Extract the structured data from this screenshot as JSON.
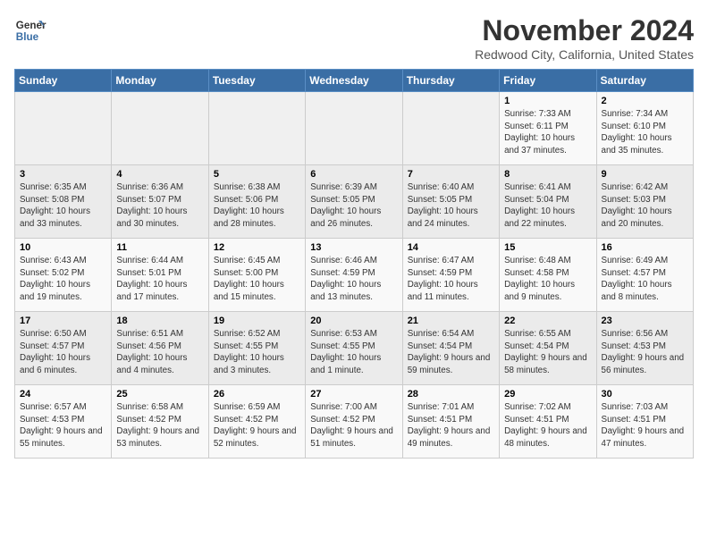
{
  "header": {
    "logo_line1": "General",
    "logo_line2": "Blue",
    "month": "November 2024",
    "location": "Redwood City, California, United States"
  },
  "weekdays": [
    "Sunday",
    "Monday",
    "Tuesday",
    "Wednesday",
    "Thursday",
    "Friday",
    "Saturday"
  ],
  "weeks": [
    [
      {
        "day": "",
        "info": ""
      },
      {
        "day": "",
        "info": ""
      },
      {
        "day": "",
        "info": ""
      },
      {
        "day": "",
        "info": ""
      },
      {
        "day": "",
        "info": ""
      },
      {
        "day": "1",
        "info": "Sunrise: 7:33 AM\nSunset: 6:11 PM\nDaylight: 10 hours\nand 37 minutes."
      },
      {
        "day": "2",
        "info": "Sunrise: 7:34 AM\nSunset: 6:10 PM\nDaylight: 10 hours\nand 35 minutes."
      }
    ],
    [
      {
        "day": "3",
        "info": "Sunrise: 6:35 AM\nSunset: 5:08 PM\nDaylight: 10 hours\nand 33 minutes."
      },
      {
        "day": "4",
        "info": "Sunrise: 6:36 AM\nSunset: 5:07 PM\nDaylight: 10 hours\nand 30 minutes."
      },
      {
        "day": "5",
        "info": "Sunrise: 6:38 AM\nSunset: 5:06 PM\nDaylight: 10 hours\nand 28 minutes."
      },
      {
        "day": "6",
        "info": "Sunrise: 6:39 AM\nSunset: 5:05 PM\nDaylight: 10 hours\nand 26 minutes."
      },
      {
        "day": "7",
        "info": "Sunrise: 6:40 AM\nSunset: 5:05 PM\nDaylight: 10 hours\nand 24 minutes."
      },
      {
        "day": "8",
        "info": "Sunrise: 6:41 AM\nSunset: 5:04 PM\nDaylight: 10 hours\nand 22 minutes."
      },
      {
        "day": "9",
        "info": "Sunrise: 6:42 AM\nSunset: 5:03 PM\nDaylight: 10 hours\nand 20 minutes."
      }
    ],
    [
      {
        "day": "10",
        "info": "Sunrise: 6:43 AM\nSunset: 5:02 PM\nDaylight: 10 hours\nand 19 minutes."
      },
      {
        "day": "11",
        "info": "Sunrise: 6:44 AM\nSunset: 5:01 PM\nDaylight: 10 hours\nand 17 minutes."
      },
      {
        "day": "12",
        "info": "Sunrise: 6:45 AM\nSunset: 5:00 PM\nDaylight: 10 hours\nand 15 minutes."
      },
      {
        "day": "13",
        "info": "Sunrise: 6:46 AM\nSunset: 4:59 PM\nDaylight: 10 hours\nand 13 minutes."
      },
      {
        "day": "14",
        "info": "Sunrise: 6:47 AM\nSunset: 4:59 PM\nDaylight: 10 hours\nand 11 minutes."
      },
      {
        "day": "15",
        "info": "Sunrise: 6:48 AM\nSunset: 4:58 PM\nDaylight: 10 hours\nand 9 minutes."
      },
      {
        "day": "16",
        "info": "Sunrise: 6:49 AM\nSunset: 4:57 PM\nDaylight: 10 hours\nand 8 minutes."
      }
    ],
    [
      {
        "day": "17",
        "info": "Sunrise: 6:50 AM\nSunset: 4:57 PM\nDaylight: 10 hours\nand 6 minutes."
      },
      {
        "day": "18",
        "info": "Sunrise: 6:51 AM\nSunset: 4:56 PM\nDaylight: 10 hours\nand 4 minutes."
      },
      {
        "day": "19",
        "info": "Sunrise: 6:52 AM\nSunset: 4:55 PM\nDaylight: 10 hours\nand 3 minutes."
      },
      {
        "day": "20",
        "info": "Sunrise: 6:53 AM\nSunset: 4:55 PM\nDaylight: 10 hours\nand 1 minute."
      },
      {
        "day": "21",
        "info": "Sunrise: 6:54 AM\nSunset: 4:54 PM\nDaylight: 9 hours\nand 59 minutes."
      },
      {
        "day": "22",
        "info": "Sunrise: 6:55 AM\nSunset: 4:54 PM\nDaylight: 9 hours\nand 58 minutes."
      },
      {
        "day": "23",
        "info": "Sunrise: 6:56 AM\nSunset: 4:53 PM\nDaylight: 9 hours\nand 56 minutes."
      }
    ],
    [
      {
        "day": "24",
        "info": "Sunrise: 6:57 AM\nSunset: 4:53 PM\nDaylight: 9 hours\nand 55 minutes."
      },
      {
        "day": "25",
        "info": "Sunrise: 6:58 AM\nSunset: 4:52 PM\nDaylight: 9 hours\nand 53 minutes."
      },
      {
        "day": "26",
        "info": "Sunrise: 6:59 AM\nSunset: 4:52 PM\nDaylight: 9 hours\nand 52 minutes."
      },
      {
        "day": "27",
        "info": "Sunrise: 7:00 AM\nSunset: 4:52 PM\nDaylight: 9 hours\nand 51 minutes."
      },
      {
        "day": "28",
        "info": "Sunrise: 7:01 AM\nSunset: 4:51 PM\nDaylight: 9 hours\nand 49 minutes."
      },
      {
        "day": "29",
        "info": "Sunrise: 7:02 AM\nSunset: 4:51 PM\nDaylight: 9 hours\nand 48 minutes."
      },
      {
        "day": "30",
        "info": "Sunrise: 7:03 AM\nSunset: 4:51 PM\nDaylight: 9 hours\nand 47 minutes."
      }
    ]
  ]
}
